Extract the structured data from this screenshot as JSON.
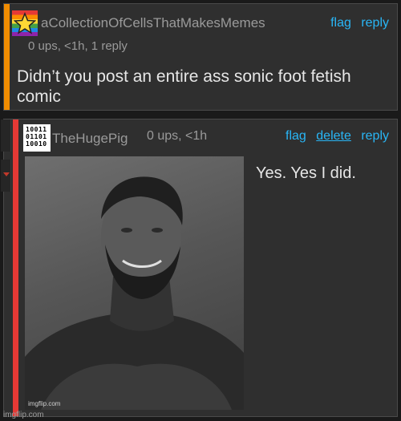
{
  "comment1": {
    "username": "aCollectionOfCellsThatMakesMemes",
    "meta": "0 ups, <1h, 1 reply",
    "flag": "flag",
    "reply": "reply",
    "body": "Didn’t you post an entire ass sonic foot fetish comic",
    "avatar_icon": "rainbow-star-icon"
  },
  "comment2": {
    "username": "TheHugePig",
    "meta": "0 ups, <1h",
    "flag": "flag",
    "delete": "delete",
    "reply": "reply",
    "body": "Yes. Yes I did.",
    "avatar_bits": [
      "10011",
      "01101",
      "10010"
    ],
    "image_watermark": "imgflip.com"
  },
  "footer": {
    "watermark": "imgflip.com"
  },
  "colors": {
    "accent_orange": "#f08c00",
    "accent_red": "#e53935",
    "link_blue": "#29b6f6",
    "panel_bg": "#2f2f2f",
    "muted_text": "#9a9a9a"
  }
}
